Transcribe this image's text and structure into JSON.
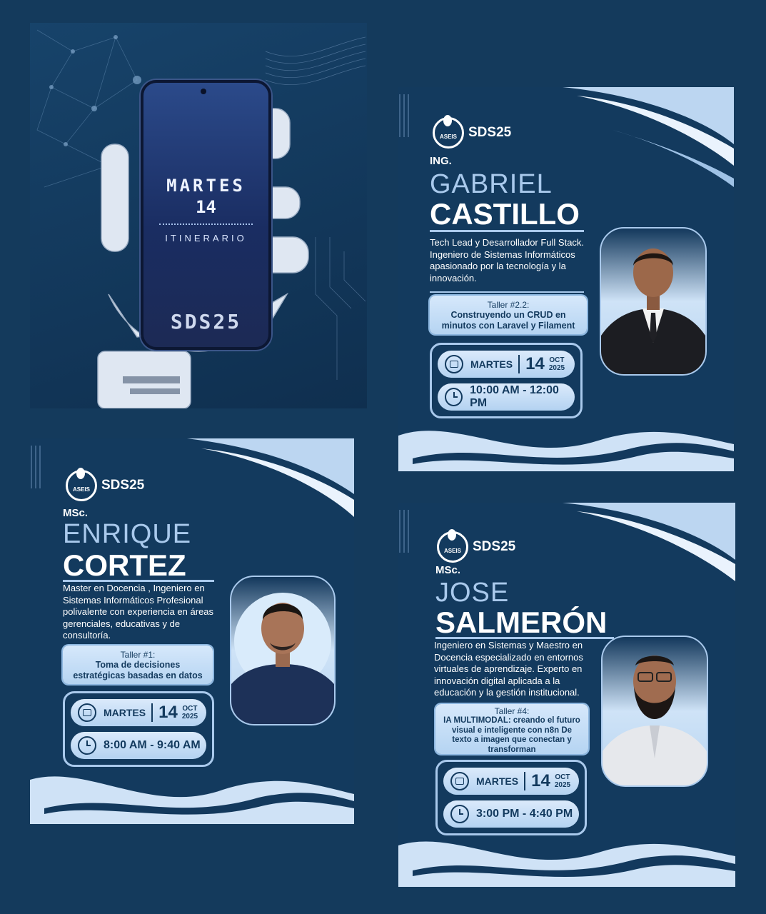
{
  "hero": {
    "day": "MARTES",
    "date": "14",
    "subtitle": "ITINERARIO",
    "brand": "SDS25"
  },
  "logo": {
    "badge_text": "ASEIS",
    "event": "SDS25"
  },
  "speakers": [
    {
      "title": "ING.",
      "first_name": "GABRIEL",
      "last_name": "CASTILLO",
      "bio": "Tech Lead y Desarrollador Full Stack. Ingeniero de Sistemas Informáticos apasionado por la tecnología y la innovación.",
      "workshop_label": "Taller #2.2:",
      "workshop_name": "Construyendo un CRUD en minutos con Laravel y Filament",
      "day": "MARTES",
      "date": "14",
      "month": "OCT",
      "year": "2025",
      "time": "10:00 AM - 12:00 PM"
    },
    {
      "title": "MSc.",
      "first_name": "ENRIQUE",
      "last_name": "CORTEZ",
      "bio": "Master en Docencia , Ingeniero en Sistemas Informáticos Profesional polivalente con experiencia en áreas gerenciales, educativas y de consultoría.",
      "workshop_label": "Taller #1:",
      "workshop_name": "Toma de decisiones estratégicas basadas en datos",
      "day": "MARTES",
      "date": "14",
      "month": "OCT",
      "year": "2025",
      "time": "8:00 AM - 9:40 AM"
    },
    {
      "title": "MSc.",
      "first_name": "JOSE",
      "last_name": "SALMERÓN",
      "bio": "Ingeniero en Sistemas y Maestro en Docencia especializado en entornos virtuales de aprendizaje. Experto en innovación digital aplicada a la educación y la gestión institucional.",
      "workshop_label": "Taller #4:",
      "workshop_name": "IA MULTIMODAL: creando el futuro visual e inteligente con n8n De texto a imagen que conectan y transforman",
      "day": "MARTES",
      "date": "14",
      "month": "OCT",
      "year": "2025",
      "time": "3:00 PM - 4:40 PM"
    }
  ],
  "colors": {
    "background": "#143a5c",
    "accent": "#a9c9ec",
    "card": "#d6e8fb"
  }
}
